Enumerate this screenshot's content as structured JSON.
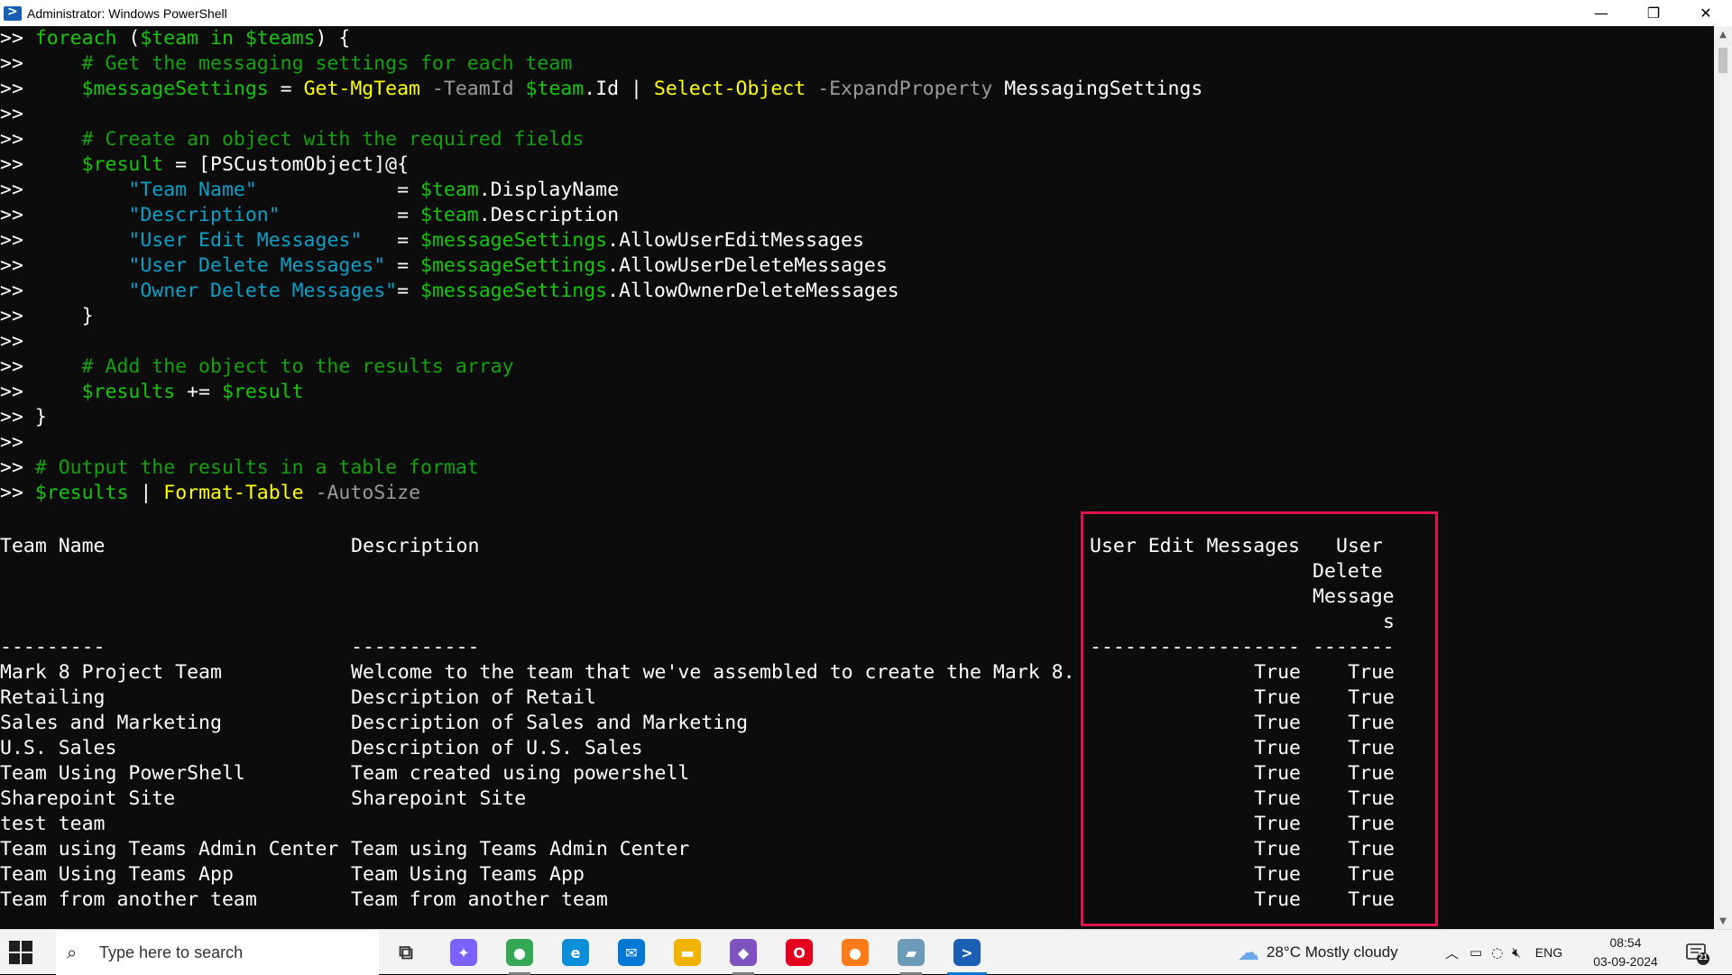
{
  "window": {
    "title": "Administrator: Windows PowerShell",
    "minimize_glyph": "—",
    "restore_glyph": "❐",
    "close_glyph": "✕"
  },
  "console": {
    "code_lines": [
      [
        {
          "t": ">> ",
          "c": "prompt"
        },
        {
          "t": "foreach",
          "c": "kwd"
        },
        {
          "t": " (",
          "c": "prompt"
        },
        {
          "t": "$team",
          "c": "var"
        },
        {
          "t": " in ",
          "c": "kwd"
        },
        {
          "t": "$teams",
          "c": "var"
        },
        {
          "t": ") {",
          "c": "prompt"
        }
      ],
      [
        {
          "t": ">>     ",
          "c": "prompt"
        },
        {
          "t": "# Get the messaging settings for each team",
          "c": "cmt"
        }
      ],
      [
        {
          "t": ">>     ",
          "c": "prompt"
        },
        {
          "t": "$messageSettings",
          "c": "var"
        },
        {
          "t": " = ",
          "c": "prompt"
        },
        {
          "t": "Get-MgTeam",
          "c": "cmd"
        },
        {
          "t": " -TeamId ",
          "c": "param"
        },
        {
          "t": "$team",
          "c": "var"
        },
        {
          "t": ".Id | ",
          "c": "prompt"
        },
        {
          "t": "Select-Object",
          "c": "cmd"
        },
        {
          "t": " -ExpandProperty ",
          "c": "param"
        },
        {
          "t": "MessagingSettings",
          "c": "prompt"
        }
      ],
      [
        {
          "t": ">>",
          "c": "prompt"
        }
      ],
      [
        {
          "t": ">>     ",
          "c": "prompt"
        },
        {
          "t": "# Create an object with the required fields",
          "c": "cmt"
        }
      ],
      [
        {
          "t": ">>     ",
          "c": "prompt"
        },
        {
          "t": "$result",
          "c": "var"
        },
        {
          "t": " = [PSCustomObject]@{",
          "c": "prompt"
        }
      ],
      [
        {
          "t": ">>         ",
          "c": "prompt"
        },
        {
          "t": "\"Team Name\"",
          "c": "str"
        },
        {
          "t": "            = ",
          "c": "prompt"
        },
        {
          "t": "$team",
          "c": "var"
        },
        {
          "t": ".DisplayName",
          "c": "prompt"
        }
      ],
      [
        {
          "t": ">>         ",
          "c": "prompt"
        },
        {
          "t": "\"Description\"",
          "c": "str"
        },
        {
          "t": "          = ",
          "c": "prompt"
        },
        {
          "t": "$team",
          "c": "var"
        },
        {
          "t": ".Description",
          "c": "prompt"
        }
      ],
      [
        {
          "t": ">>         ",
          "c": "prompt"
        },
        {
          "t": "\"User Edit Messages\"",
          "c": "str"
        },
        {
          "t": "   = ",
          "c": "prompt"
        },
        {
          "t": "$messageSettings",
          "c": "var"
        },
        {
          "t": ".AllowUserEditMessages",
          "c": "prompt"
        }
      ],
      [
        {
          "t": ">>         ",
          "c": "prompt"
        },
        {
          "t": "\"User Delete Messages\"",
          "c": "str"
        },
        {
          "t": " = ",
          "c": "prompt"
        },
        {
          "t": "$messageSettings",
          "c": "var"
        },
        {
          "t": ".AllowUserDeleteMessages",
          "c": "prompt"
        }
      ],
      [
        {
          "t": ">>         ",
          "c": "prompt"
        },
        {
          "t": "\"Owner Delete Messages\"",
          "c": "str"
        },
        {
          "t": "= ",
          "c": "prompt"
        },
        {
          "t": "$messageSettings",
          "c": "var"
        },
        {
          "t": ".AllowOwnerDeleteMessages",
          "c": "prompt"
        }
      ],
      [
        {
          "t": ">>     }",
          "c": "prompt"
        }
      ],
      [
        {
          "t": ">>",
          "c": "prompt"
        }
      ],
      [
        {
          "t": ">>     ",
          "c": "prompt"
        },
        {
          "t": "# Add the object to the results array",
          "c": "cmt"
        }
      ],
      [
        {
          "t": ">>     ",
          "c": "prompt"
        },
        {
          "t": "$results",
          "c": "var"
        },
        {
          "t": " += ",
          "c": "prompt"
        },
        {
          "t": "$result",
          "c": "var"
        }
      ],
      [
        {
          "t": ">> }",
          "c": "prompt"
        }
      ],
      [
        {
          "t": ">>",
          "c": "prompt"
        }
      ],
      [
        {
          "t": ">> ",
          "c": "prompt"
        },
        {
          "t": "# Output the results in a table format",
          "c": "cmt"
        }
      ],
      [
        {
          "t": ">> ",
          "c": "prompt"
        },
        {
          "t": "$results",
          "c": "var"
        },
        {
          "t": " | ",
          "c": "prompt"
        },
        {
          "t": "Format-Table",
          "c": "cmd"
        },
        {
          "t": " -AutoSize",
          "c": "param"
        }
      ]
    ],
    "table": {
      "headers": {
        "team_name": "Team Name",
        "description": "Description",
        "user_edit": "User Edit Messages",
        "user_delete_lines": [
          "User",
          "Delete",
          "Message",
          "s"
        ]
      },
      "underlines": {
        "team_name": "---------",
        "description": "-----------",
        "user_edit": "------------------",
        "user_delete": "-------"
      },
      "rows": [
        {
          "team": "Mark 8 Project Team",
          "desc": "Welcome to the team that we've assembled to create the Mark 8.",
          "edit": "True",
          "del": "True"
        },
        {
          "team": "Retailing",
          "desc": "Description of Retail",
          "edit": "True",
          "del": "True"
        },
        {
          "team": "Sales and Marketing",
          "desc": "Description of Sales and Marketing",
          "edit": "True",
          "del": "True"
        },
        {
          "team": "U.S. Sales",
          "desc": "Description of U.S. Sales",
          "edit": "True",
          "del": "True"
        },
        {
          "team": "Team Using PowerShell",
          "desc": "Team created using powershell",
          "edit": "True",
          "del": "True"
        },
        {
          "team": "Sharepoint Site",
          "desc": "Sharepoint Site",
          "edit": "True",
          "del": "True"
        },
        {
          "team": "test team",
          "desc": "",
          "edit": "True",
          "del": "True"
        },
        {
          "team": "Team using Teams Admin Center",
          "desc": "Team using Teams Admin Center",
          "edit": "True",
          "del": "True"
        },
        {
          "team": "Team Using Teams App",
          "desc": "Team Using Teams App",
          "edit": "True",
          "del": "True"
        },
        {
          "team": "Team from another team",
          "desc": "Team from another team",
          "edit": "True",
          "del": "True"
        }
      ]
    }
  },
  "taskbar": {
    "search_placeholder": "Type here to search",
    "search_icon": "⌕",
    "weather": "28°C  Mostly cloudy",
    "language": "ENG",
    "time": "08:54",
    "date": "03-09-2024",
    "notification_count": "21",
    "apps": [
      {
        "name": "task-view",
        "glyph": "⧉",
        "color": "#333333"
      },
      {
        "name": "copilot",
        "glyph": "✦",
        "color": "#7b61ff"
      },
      {
        "name": "chrome",
        "glyph": "●",
        "color": "#34a853"
      },
      {
        "name": "edge",
        "glyph": "e",
        "color": "#0c8fd8"
      },
      {
        "name": "mail",
        "glyph": "✉",
        "color": "#0078d4"
      },
      {
        "name": "file-explorer",
        "glyph": "▬",
        "color": "#f2b400"
      },
      {
        "name": "visual-studio",
        "glyph": "◆",
        "color": "#7e53c0"
      },
      {
        "name": "opera",
        "glyph": "O",
        "color": "#e5001f"
      },
      {
        "name": "firefox",
        "glyph": "●",
        "color": "#ff7a18"
      },
      {
        "name": "notes",
        "glyph": "▰",
        "color": "#6c9bb8"
      },
      {
        "name": "powershell",
        "glyph": ">",
        "color": "#1b5fb5"
      }
    ],
    "colors": {
      "accent": "#0078d4"
    }
  },
  "colors": {
    "console_bg": "#0c0c0c",
    "highlight_border": "#e0144c",
    "variable": "#16c60c",
    "command": "#ffff00",
    "string": "#0aa0c8",
    "parameter": "#9a9a9a"
  }
}
